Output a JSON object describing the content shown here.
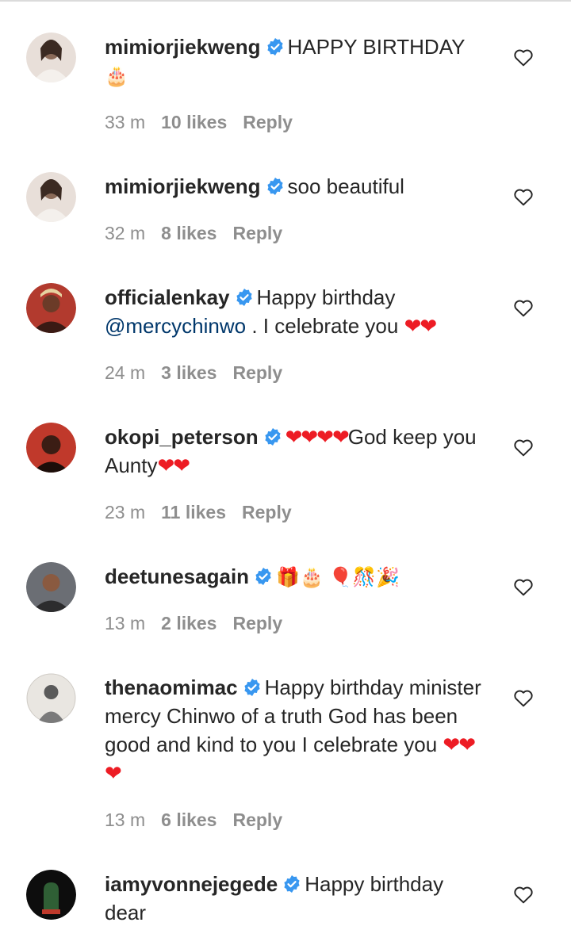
{
  "comments": [
    {
      "username": "mimiorjiekweng",
      "text": "HAPPY BIRTHDAY",
      "emoji": "🎂",
      "time": "33 m",
      "likes": "10 likes",
      "reply": "Reply",
      "avatar_colors": [
        "#6d5a4f",
        "#e8dfd9"
      ]
    },
    {
      "username": "mimiorjiekweng",
      "text": "soo beautiful",
      "time": "32 m",
      "likes": "8 likes",
      "reply": "Reply",
      "avatar_colors": [
        "#6d5a4f",
        "#e8dfd9"
      ]
    },
    {
      "username": "officialenkay",
      "text": "Happy birthday",
      "mention": "@mercychinwo",
      "text2": " . I celebrate you ",
      "hearts": "❤❤",
      "time": "24 m",
      "likes": "3 likes",
      "reply": "Reply",
      "avatar_colors": [
        "#b23a2e",
        "#3a1a14"
      ]
    },
    {
      "username": "okopi_peterson",
      "hearts1": "❤❤❤❤",
      "text": "God keep you Aunty",
      "hearts2": "❤❤",
      "time": "23 m",
      "likes": "11 likes",
      "reply": "Reply",
      "avatar_colors": [
        "#c0392b",
        "#3b1d14"
      ]
    },
    {
      "username": "deetunesagain",
      "emoji": "🎁🎂 🎈🎊🎉",
      "time": "13 m",
      "likes": "2 likes",
      "reply": "Reply",
      "avatar_colors": [
        "#6b6e74",
        "#2c2c2e"
      ]
    },
    {
      "username": "thenaomimac",
      "text": "Happy birthday minister mercy Chinwo of a truth God has been good and kind to you I celebrate you ",
      "hearts": "❤❤❤",
      "time": "13 m",
      "likes": "6 likes",
      "reply": "Reply",
      "avatar_colors": [
        "#e9e6e1",
        "#5a5a5a"
      ]
    },
    {
      "username": "iamyvonnejegede",
      "text": "Happy birthday dear",
      "avatar_colors": [
        "#1f3b22",
        "#0d0d0d"
      ]
    }
  ],
  "colors": {
    "text": "#262626",
    "meta": "#8e8e8e",
    "mention": "#00376b",
    "verified": "#3897f0",
    "heart": "#ed1c24"
  },
  "icons": {
    "verified": "verified-badge-icon",
    "like": "heart-outline-icon"
  }
}
